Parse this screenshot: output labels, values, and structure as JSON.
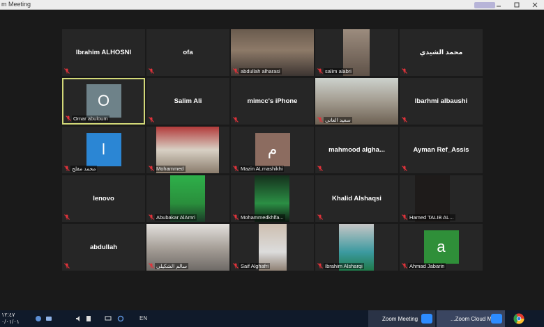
{
  "window": {
    "title": "m Meeting"
  },
  "colors": {
    "background": "#1a1a1a",
    "tile": "#262626",
    "active_speaker_border": "#d2d878",
    "mute": "#e0333a",
    "zoom_blue": "#2d8cff"
  },
  "participants": [
    {
      "name": "Ibrahim ALHOSNI",
      "label": "",
      "kind": "name"
    },
    {
      "name": "ofa",
      "label": "",
      "kind": "name"
    },
    {
      "name": "",
      "label": "abdullah alharasi",
      "kind": "video"
    },
    {
      "name": "",
      "label": "salim alabri",
      "kind": "video"
    },
    {
      "name": "محمد الشيدي",
      "label": "",
      "kind": "name"
    },
    {
      "name": "",
      "label": "Omar abuloum",
      "kind": "avatar",
      "initial": "O",
      "avatar_color": "#6e8289",
      "active": true
    },
    {
      "name": "Salim Ali",
      "label": "",
      "kind": "name"
    },
    {
      "name": "mimcc's iPhone",
      "label": "",
      "kind": "name"
    },
    {
      "name": "",
      "label": "سعيد العاني",
      "kind": "video"
    },
    {
      "name": "Ibarhmi albaushi",
      "label": "",
      "kind": "name"
    },
    {
      "name": "",
      "label": "محمد مقلح",
      "kind": "avatar",
      "initial": "l",
      "avatar_color": "#2b86d4"
    },
    {
      "name": "",
      "label": "Mohammed",
      "kind": "video"
    },
    {
      "name": "",
      "label": "Mazin ALmashikhi",
      "kind": "avatar",
      "initial": "م",
      "avatar_color": "#8c6c60"
    },
    {
      "name": "mahmood alghа...",
      "label": "",
      "kind": "name"
    },
    {
      "name": "Ayman Ref_Assis",
      "label": "",
      "kind": "name"
    },
    {
      "name": "lenovo",
      "label": "",
      "kind": "name"
    },
    {
      "name": "",
      "label": "Abubakar AlAmri",
      "kind": "video"
    },
    {
      "name": "",
      "label": "Mohammedkhlfa...",
      "kind": "video"
    },
    {
      "name": "Khalid Alshaqsi",
      "label": "",
      "kind": "name"
    },
    {
      "name": "",
      "label": "Hamed TALIB AL...",
      "kind": "video"
    },
    {
      "name": "abdullah",
      "label": "",
      "kind": "name"
    },
    {
      "name": "",
      "label": "سالم الشكيلي",
      "kind": "video"
    },
    {
      "name": "",
      "label": "Saif Alghafri",
      "kind": "video"
    },
    {
      "name": "",
      "label": "Ibrahim Alsharqi",
      "kind": "video"
    },
    {
      "name": "",
      "label": "Ahmad Jabarin",
      "kind": "avatar",
      "initial": "a",
      "avatar_color": "#2f8f39"
    }
  ],
  "taskbar": {
    "time": "١٢:٤٧",
    "date": "٠/٠١/٠١",
    "language": "EN",
    "apps": [
      {
        "label": "Zoom Meeting"
      },
      {
        "label": "...Zoom Cloud Mee"
      }
    ]
  }
}
